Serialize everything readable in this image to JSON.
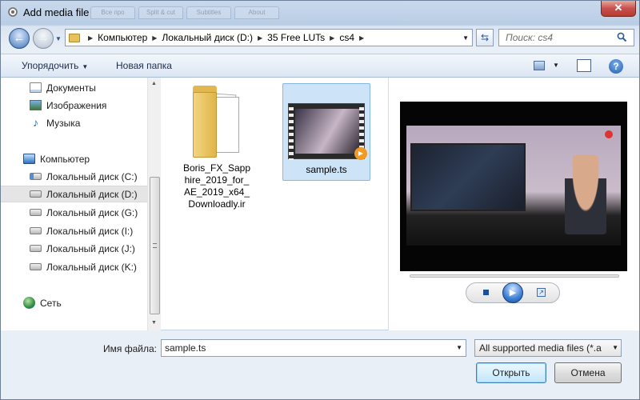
{
  "window": {
    "title": "Add media file",
    "close_label": "✕",
    "ghost_tabs": [
      "Все про",
      "Split & cut",
      "Subtitles",
      "About"
    ]
  },
  "nav": {
    "back_symbol": "←",
    "forward_symbol": "→",
    "breadcrumbs": [
      "Компьютер",
      "Локальный диск (D:)",
      "35 Free LUTs",
      "cs4"
    ],
    "search_placeholder": "Поиск: cs4"
  },
  "toolbar": {
    "organize": "Упорядочить",
    "new_folder": "Новая папка",
    "help": "?"
  },
  "sidebar": {
    "items": [
      {
        "label": "Документы",
        "icon": "documents-icon"
      },
      {
        "label": "Изображения",
        "icon": "pictures-icon"
      },
      {
        "label": "Музыка",
        "icon": "music-icon"
      },
      {
        "label": "Компьютер",
        "icon": "computer-icon"
      },
      {
        "label": "Локальный диск (C:)",
        "icon": "drive-icon"
      },
      {
        "label": "Локальный диск (D:)",
        "icon": "drive-icon",
        "selected": true
      },
      {
        "label": "Локальный диск (G:)",
        "icon": "drive-icon"
      },
      {
        "label": "Локальный диск (I:)",
        "icon": "drive-icon"
      },
      {
        "label": "Локальный диск (J:)",
        "icon": "drive-icon"
      },
      {
        "label": "Локальный диск (K:)",
        "icon": "drive-icon"
      },
      {
        "label": "Сеть",
        "icon": "network-icon"
      }
    ]
  },
  "files": [
    {
      "name": "Boris_FX_Sapphire_2019_for_AE_2019_x64_Downloadly.ir",
      "type": "folder"
    },
    {
      "name": "sample.ts",
      "type": "video",
      "selected": true
    }
  ],
  "bottom": {
    "filename_label": "Имя файла:",
    "filename_value": "sample.ts",
    "filter_value": "All supported media files (*.a",
    "open_button": "Открыть",
    "cancel_button": "Отмена"
  }
}
